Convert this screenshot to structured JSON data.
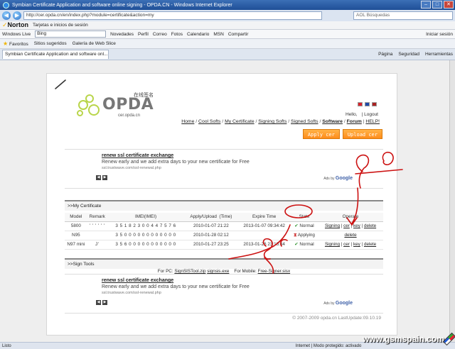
{
  "window": {
    "title": "Symbian Certificate Application and software online signing - OPDA.CN - Windows Internet Explorer"
  },
  "address_bar": {
    "url": "http://cer.opda.cn/en/index.php?module=certificate&action=my",
    "search_placeholder": "AOL Búsquedas"
  },
  "norton_bar": {
    "brand": "Norton",
    "item": "Tarjetas e inicios de sesión"
  },
  "live_bar": {
    "brand": "Windows Live",
    "search_value": "Bing",
    "items": [
      "Novedades",
      "Perfil",
      "Correo",
      "Fotos",
      "Calendario",
      "MSN",
      "Compartir"
    ],
    "signin": "Iniciar sesión"
  },
  "favorites_bar": {
    "favorites": "Favoritos",
    "items": [
      "Sitios sugeridos",
      "Galería de Web Slice"
    ]
  },
  "tab": {
    "label": "Symbian Certificate Application and software onl...",
    "tools": [
      "Página",
      "Seguridad",
      "Herramientas"
    ]
  },
  "site": {
    "logo_word": "OPDA",
    "logo_sub": "cer.opda.cn",
    "logo_cn": "在线签名",
    "flag_colors": [
      "#d8222a",
      "#1f4aa8",
      "#aa2222"
    ],
    "greeting": "Hello,",
    "logout": "| Logout",
    "menu": [
      {
        "label": "Home",
        "bold": false
      },
      {
        "label": "Cool Softs",
        "bold": false
      },
      {
        "label": "My Certificate",
        "bold": false
      },
      {
        "label": "Signing Softs",
        "bold": false
      },
      {
        "label": "Signed Softs",
        "bold": false
      },
      {
        "label": "Software",
        "bold": true
      },
      {
        "label": "Forum",
        "bold": true
      },
      {
        "label": "HELP!",
        "bold": false
      }
    ],
    "apply_button": "Apply cer",
    "upload_button": "Upload cer"
  },
  "ad": {
    "title": "renew ssl certificate exchange",
    "text": "Renew early and we add extra days to your new certificate for Free",
    "url": "ssl.trustwave.com/ssl-renewal.php",
    "ads_by": "Ads by",
    "google": "Google"
  },
  "my_certificate": {
    "heading": ">>My Certificate",
    "columns": [
      "Model",
      "Remark",
      "IMEI(IMEI)",
      "Apply/Upload  (Time)",
      "Expire Time",
      "State",
      "Operate"
    ],
    "rows": [
      {
        "model": "5800",
        "remark": "' ' ' ' ' '",
        "imei": "3 5 1 8 2 3 0 0 4 4 7 5 7 6",
        "apply": "2010-01-07 21:22",
        "expire": "2013-01-07 09:34:42",
        "state": "Normal",
        "state_icon": "check",
        "ops": [
          "Signing",
          "cer",
          "key",
          "delete"
        ]
      },
      {
        "model": "N95",
        "remark": "",
        "imei": "3 5 0 0 0 0 0 0 0 0 0 0 0 0",
        "apply": "2010-01-28 02:12",
        "expire": "",
        "state": "Applying",
        "state_icon": "hourglass",
        "ops": [
          "delete"
        ]
      },
      {
        "model": "N97 mini",
        "remark": "J'",
        "imei": "3 5 6 0 0 0 0 0 0 0 0 0 0 0",
        "apply": "2010-01-27 23:25",
        "expire": "2013-01-26 23:16:34",
        "state": "Normal",
        "state_icon": "check",
        "ops": [
          "Signing",
          "cer",
          "key",
          "delete"
        ]
      }
    ]
  },
  "sign_tools": {
    "heading": ">>Sign Tools",
    "pc_label": "For PC:",
    "pc_tools": [
      "SignSISTool.zip",
      "signsis.exe"
    ],
    "mobile_label": "For Mobile:",
    "mobile_tool": "Free-Signer.sisx"
  },
  "footer": {
    "text": "© 2007-2009 opda.cn LastUpdate:09.10.19"
  },
  "status_bar": {
    "left": "Listo",
    "middle": "Internet | Modo protegido: activado",
    "watermark": "www.gsmspain.com"
  },
  "annotation_color": "#cc1111"
}
